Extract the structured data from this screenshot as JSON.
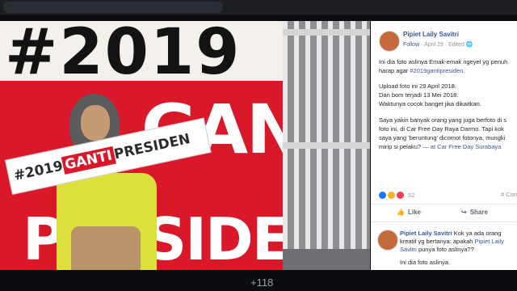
{
  "post": {
    "author": "Pipiet Laily Savitri",
    "follow_label": "Follow",
    "date": "April 29",
    "edited": "Edited",
    "lines": [
      "Ini dia foto aslinya Emak-emak ngeyel yg penuh",
      "harap agar",
      "Upload foto ini 29 April 2018.",
      "Dan bom terjadi 13 Mei 2018.",
      "Waktunya cocok banget jika dikaitkan.",
      "Saya yakin banyak orang yang juga berfoto di s",
      "foto ini, di Car Free Day Raya Darmo. Tapi kok",
      "saya yang 'beruntung' dicomot fotonya, mungki",
      "mirip si pelaku?",
      "Car Free Day Surabaya"
    ],
    "hashtag": "#2019gantipresiden.",
    "at_label": "— at",
    "reactions_count": "52",
    "comments_label": "# Com"
  },
  "actions": {
    "like": "Like",
    "share": "Share"
  },
  "comment": {
    "author": "Pipiet Laily Savitri",
    "text1": "Kok ya ada orang kreatif yg bertanya: apakah",
    "mention": "Pipiet Laily Savitri",
    "text2": "punya foto aslinya??",
    "text3": "Ini dia foto aslinya."
  },
  "photo": {
    "billboard_top": "#2019",
    "billboard_mid": "GANTI",
    "billboard_bottom": "PRESIDEN",
    "sign_part1": "#2019",
    "sign_part2": "GANTI",
    "sign_part3": "PRESIDEN"
  },
  "viewer": {
    "counter": "+118"
  },
  "colors": {
    "fb_blue": "#385898",
    "billboard_red": "#d9182a",
    "like_blue": "#1877f2",
    "haha_yellow": "#f7b125",
    "love_red": "#f33e58"
  }
}
